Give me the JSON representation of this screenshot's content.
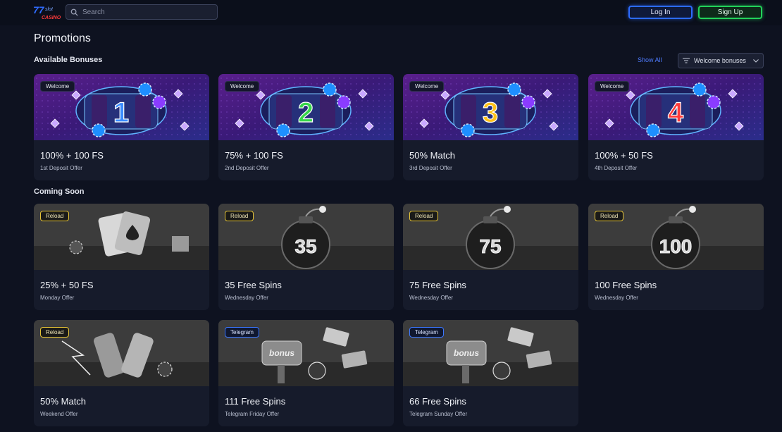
{
  "header": {
    "logo_text": "777 CASINO",
    "search_placeholder": "Search",
    "login_label": "Log In",
    "signup_label": "Sign Up"
  },
  "page": {
    "title": "Promotions"
  },
  "available": {
    "title": "Available Bonuses",
    "show_all": "Show All",
    "filter_label": "Welcome bonuses",
    "cards": [
      {
        "badge": "Welcome",
        "title": "100% + 100 FS",
        "sub": "1st Deposit Offer",
        "number": "1",
        "num_color": "#3a8cff"
      },
      {
        "badge": "Welcome",
        "title": "75% + 100 FS",
        "sub": "2nd Deposit Offer",
        "number": "2",
        "num_color": "#37d64a"
      },
      {
        "badge": "Welcome",
        "title": "50% Match",
        "sub": "3rd Deposit Offer",
        "number": "3",
        "num_color": "#ffc21a"
      },
      {
        "badge": "Welcome",
        "title": "100% + 50 FS",
        "sub": "4th Deposit Offer",
        "number": "4",
        "num_color": "#ff3b3b"
      }
    ]
  },
  "coming": {
    "title": "Coming Soon",
    "cards": [
      {
        "badge": "Reload",
        "title": "25% + 50 FS",
        "sub": "Monday Offer",
        "art": "cards"
      },
      {
        "badge": "Reload",
        "title": "35 Free Spins",
        "sub": "Wednesday Offer",
        "art": "bomb",
        "number": "35"
      },
      {
        "badge": "Reload",
        "title": "75 Free Spins",
        "sub": "Wednesday Offer",
        "art": "bomb",
        "number": "75"
      },
      {
        "badge": "Reload",
        "title": "100 Free Spins",
        "sub": "Wednesday Offer",
        "art": "bomb",
        "number": "100"
      },
      {
        "badge": "Reload",
        "title": "50% Match",
        "sub": "Weekend Offer",
        "art": "bottles"
      },
      {
        "badge": "Telegram",
        "title": "111 Free Spins",
        "sub": "Telegram Friday Offer",
        "art": "bonus"
      },
      {
        "badge": "Telegram",
        "title": "66 Free Spins",
        "sub": "Telegram Sunday Offer",
        "art": "bonus"
      }
    ]
  }
}
